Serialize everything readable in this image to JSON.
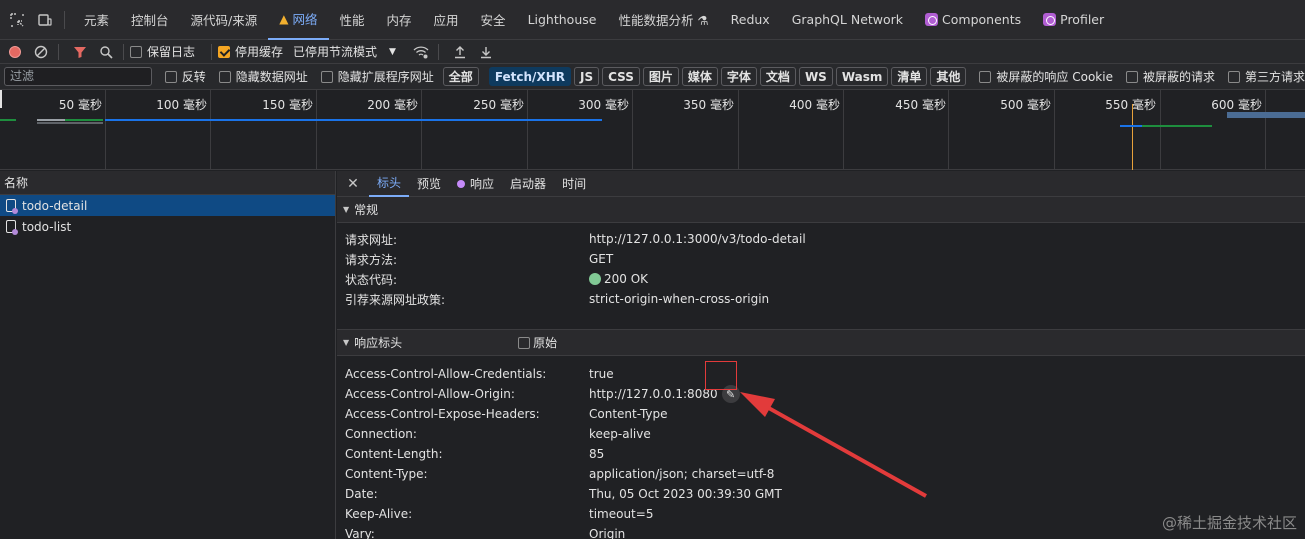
{
  "main_tabs": [
    {
      "label": "元素"
    },
    {
      "label": "控制台"
    },
    {
      "label": "源代码/来源"
    },
    {
      "label": "网络"
    },
    {
      "label": "性能"
    },
    {
      "label": "内存"
    },
    {
      "label": "应用"
    },
    {
      "label": "安全"
    },
    {
      "label": "Lighthouse"
    },
    {
      "label": "性能数据分析 ⚗"
    },
    {
      "label": "Redux"
    },
    {
      "label": "GraphQL Network"
    },
    {
      "label": "Components"
    },
    {
      "label": "Profiler"
    }
  ],
  "toolbar": {
    "preserve_log": "保留日志",
    "disable_cache": "停用缓存",
    "throttling": "已停用节流模式"
  },
  "filter": {
    "placeholder": "过滤",
    "invert": "反转",
    "hide_data_urls": "隐藏数据网址",
    "hide_ext_urls": "隐藏扩展程序网址",
    "types": [
      "全部",
      "Fetch/XHR",
      "JS",
      "CSS",
      "图片",
      "媒体",
      "字体",
      "文档",
      "WS",
      "Wasm",
      "清单",
      "其他"
    ],
    "blocked_cookies": "被屏蔽的响应 Cookie",
    "blocked_requests": "被屏蔽的请求",
    "third_party": "第三方请求"
  },
  "timeline": {
    "ticks": [
      "50 毫秒",
      "100 毫秒",
      "150 毫秒",
      "200 毫秒",
      "250 毫秒",
      "300 毫秒",
      "350 毫秒",
      "400 毫秒",
      "450 毫秒",
      "500 毫秒",
      "550 毫秒",
      "600 毫秒"
    ]
  },
  "request_list": {
    "header": "名称",
    "items": [
      {
        "name": "todo-detail"
      },
      {
        "name": "todo-list"
      }
    ]
  },
  "detail_tabs": [
    "标头",
    "预览",
    "响应",
    "启动器",
    "时间"
  ],
  "general": {
    "title": "常规",
    "rows": [
      {
        "k": "请求网址:",
        "v": "http://127.0.0.1:3000/v3/todo-detail"
      },
      {
        "k": "请求方法:",
        "v": "GET"
      },
      {
        "k": "状态代码:",
        "v": "200 OK"
      },
      {
        "k": "引荐来源网址政策:",
        "v": "strict-origin-when-cross-origin"
      }
    ]
  },
  "response_headers": {
    "title": "响应标头",
    "raw_label": "原始",
    "rows": [
      {
        "k": "Access-Control-Allow-Credentials:",
        "v": "true"
      },
      {
        "k": "Access-Control-Allow-Origin:",
        "v": "http://127.0.0.1:8080"
      },
      {
        "k": "Access-Control-Expose-Headers:",
        "v": "Content-Type"
      },
      {
        "k": "Connection:",
        "v": "keep-alive"
      },
      {
        "k": "Content-Length:",
        "v": "85"
      },
      {
        "k": "Content-Type:",
        "v": "application/json; charset=utf-8"
      },
      {
        "k": "Date:",
        "v": "Thu, 05 Oct 2023 00:39:30 GMT"
      },
      {
        "k": "Keep-Alive:",
        "v": "timeout=5"
      },
      {
        "k": "Vary:",
        "v": "Origin"
      }
    ]
  },
  "watermark": "@稀土掘金技术社区",
  "colors": {
    "accent": "#7cacf8",
    "annotation": "#e23b3b"
  }
}
